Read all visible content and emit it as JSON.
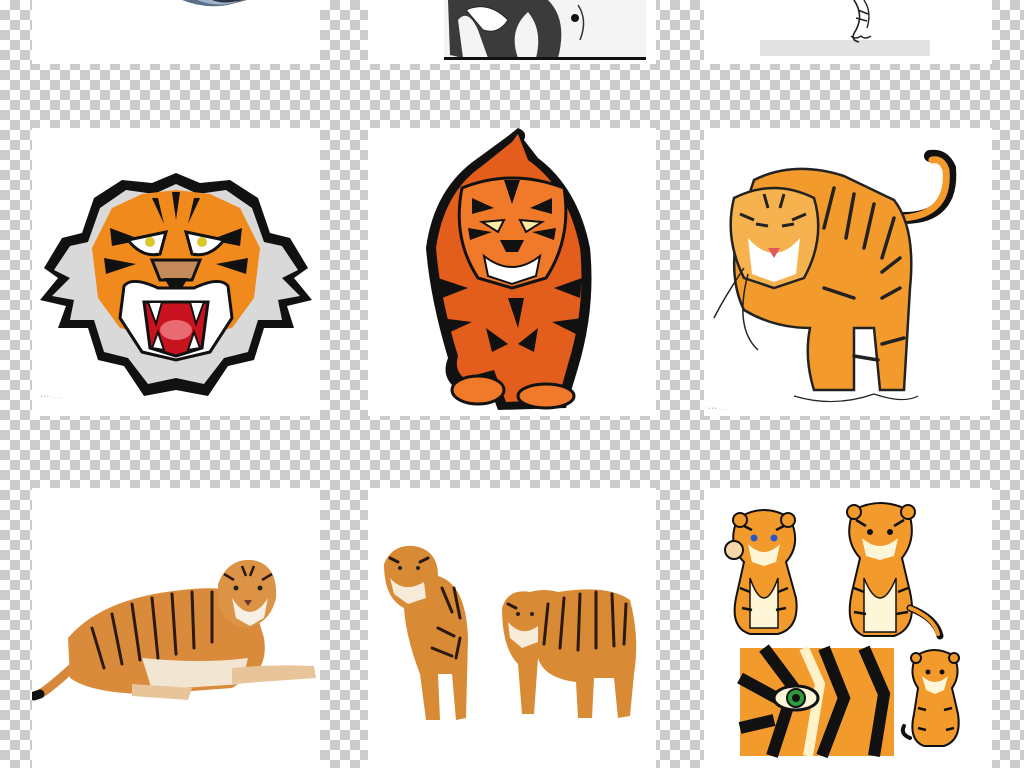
{
  "gallery": {
    "background": "transparency-checkerboard",
    "tiles": [
      {
        "name": "snow-tiger-partial",
        "style": "photo"
      },
      {
        "name": "sketch-tiger-partial",
        "style": "ink-sketch"
      },
      {
        "name": "line-tiger-partial",
        "style": "line-drawing"
      },
      {
        "name": "roaring-tiger-head",
        "style": "mascot-illustration"
      },
      {
        "name": "prowling-tiger-front",
        "style": "bold-illustration"
      },
      {
        "name": "walking-tiger-cartoon",
        "style": "cartoon"
      },
      {
        "name": "lying-tiger-photo",
        "style": "photo-cutout"
      },
      {
        "name": "two-standing-tigers-photo",
        "style": "photo-cutout"
      },
      {
        "name": "tiger-cubs-cartoon-set",
        "style": "cartoon"
      }
    ]
  },
  "colors": {
    "tiger_orange": "#f08a1c",
    "stripe": "#111111",
    "mouth_red": "#c8131f",
    "eye_green": "#2f9a3a"
  }
}
